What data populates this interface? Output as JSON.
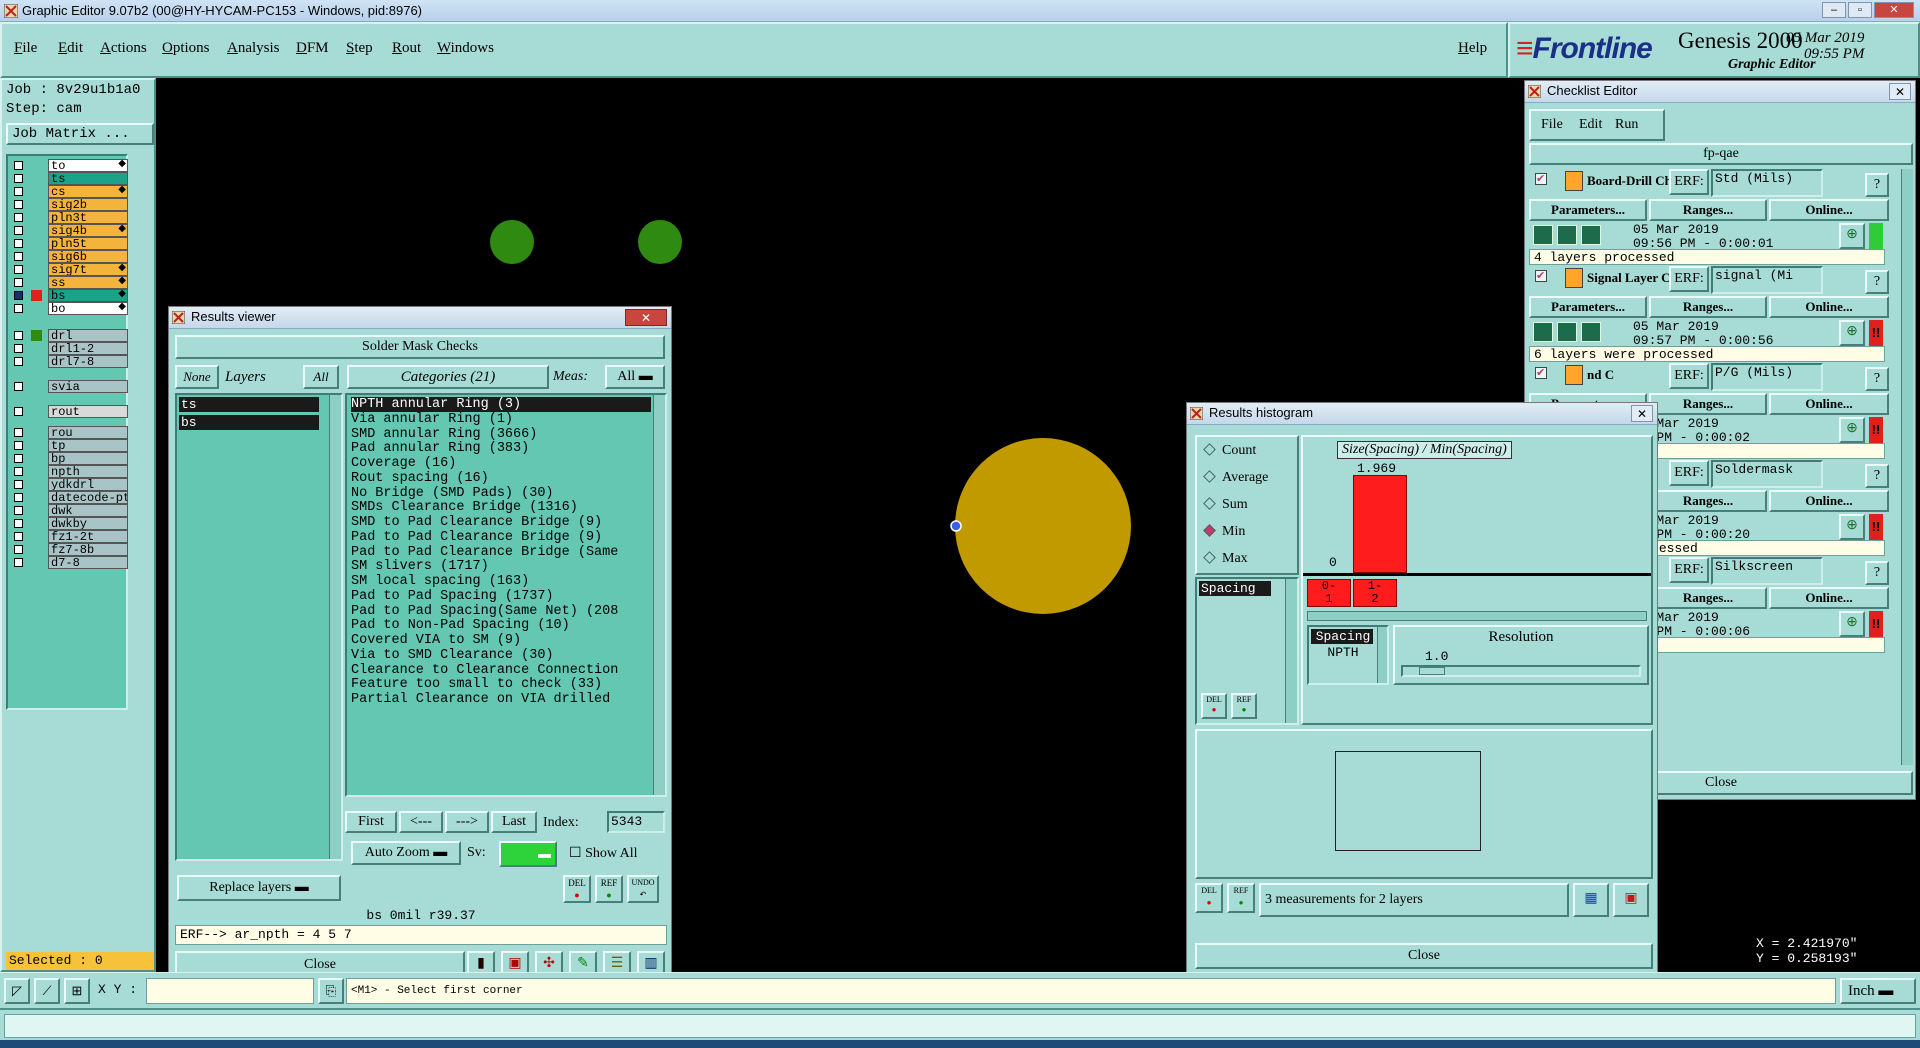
{
  "window": {
    "title": "Graphic Editor 9.07b2 (00@HY-HYCAM-PC153 - Windows, pid:8976)",
    "buttons": [
      "–",
      "▫",
      "✕"
    ]
  },
  "menu": {
    "items": [
      "File",
      "Edit",
      "Actions",
      "Options",
      "Analysis",
      "DFM",
      "Step",
      "Rout",
      "Windows"
    ],
    "help": "Help"
  },
  "brand": {
    "logo": "Frontline",
    "product": "Genesis 2000",
    "subtitle": "Graphic Editor",
    "date": "05 Mar 2019",
    "time": "09:55 PM"
  },
  "left": {
    "job": "Job : 8v29u1b1a0",
    "step": "Step: cam",
    "job_matrix": "Job Matrix ...",
    "selected": "Selected : 0",
    "layers": [
      {
        "name": "to",
        "color": "#ffffff",
        "mark": "◆"
      },
      {
        "name": "ts",
        "color": "#1aa389",
        "mark": ""
      },
      {
        "name": "cs",
        "color": "#f4b43c",
        "mark": "◆"
      },
      {
        "name": "sig2b",
        "color": "#f4b43c",
        "mark": ""
      },
      {
        "name": "pln3t",
        "color": "#f4b43c",
        "mark": ""
      },
      {
        "name": "sig4b",
        "color": "#f4b43c",
        "mark": "◆"
      },
      {
        "name": "pln5t",
        "color": "#f4b43c",
        "mark": ""
      },
      {
        "name": "sig6b",
        "color": "#f4b43c",
        "mark": ""
      },
      {
        "name": "sig7t",
        "color": "#f4b43c",
        "mark": "◆"
      },
      {
        "name": "ss",
        "color": "#f4b43c",
        "mark": "◆"
      },
      {
        "name": "bs",
        "color": "#1aa389",
        "mark": "◆"
      },
      {
        "name": "bo",
        "color": "#ffffff",
        "mark": "◆"
      },
      {
        "name": "drl",
        "color": "#a9c4c7",
        "mark": ""
      },
      {
        "name": "drl1-2",
        "color": "#a9c4c7",
        "mark": ""
      },
      {
        "name": "drl7-8",
        "color": "#a9c4c7",
        "mark": ""
      },
      {
        "name": "svia",
        "color": "#a9c4c7",
        "mark": ""
      },
      {
        "name": "rout",
        "color": "#d9d9d9",
        "mark": ""
      },
      {
        "name": "rou",
        "color": "#a9c4c7",
        "mark": ""
      },
      {
        "name": "tp",
        "color": "#a9c4c7",
        "mark": ""
      },
      {
        "name": "bp",
        "color": "#a9c4c7",
        "mark": ""
      },
      {
        "name": "npth",
        "color": "#a9c4c7",
        "mark": ""
      },
      {
        "name": "ydkdrl",
        "color": "#a9c4c7",
        "mark": ""
      },
      {
        "name": "datecode-pt",
        "color": "#a9c4c7",
        "mark": ""
      },
      {
        "name": "dwk",
        "color": "#a9c4c7",
        "mark": ""
      },
      {
        "name": "dwkby",
        "color": "#a9c4c7",
        "mark": ""
      },
      {
        "name": "fz1-2t",
        "color": "#a9c4c7",
        "mark": ""
      },
      {
        "name": "fz7-8b",
        "color": "#a9c4c7",
        "mark": ""
      },
      {
        "name": "d7-8",
        "color": "#a9c4c7",
        "mark": ""
      }
    ]
  },
  "results_viewer": {
    "title": "Results viewer",
    "header": "Solder Mask Checks",
    "none_btn": "None",
    "layers_label": "Layers",
    "all_btn": "All",
    "categories_label": "Categories (21)",
    "meas_label": "Meas:",
    "meas_value": "All",
    "layers": [
      "ts",
      "bs"
    ],
    "categories": [
      "NPTH annular Ring (3)",
      "Via annular Ring (1)",
      "SMD annular Ring (3666)",
      "Pad annular Ring (383)",
      "Coverage (16)",
      "Rout spacing (16)",
      "No Bridge (SMD Pads) (30)",
      "SMDs Clearance Bridge (1316)",
      "SMD to Pad Clearance Bridge (9)",
      "Pad to Pad Clearance Bridge (9)",
      "Pad to Pad Clearance Bridge (Same",
      "SM slivers (1717)",
      "SM local spacing (163)",
      "Pad to Pad Spacing (1737)",
      "Pad to Pad Spacing(Same Net) (208",
      "Pad to Non-Pad Spacing (10)",
      "Covered VIA to SM (9)",
      "Via to SMD Clearance (30)",
      "Clearance to Clearance Connection",
      "Feature too small to check (33)",
      "Partial Clearance on VIA drilled"
    ],
    "first": "First",
    "prev": "<---",
    "next": "--->",
    "last": "Last",
    "index_label": "Index:",
    "index_value": "5343",
    "auto_zoom": "Auto Zoom",
    "sv_label": "Sv:",
    "show_all": "Show All",
    "replace_layers": "Replace layers",
    "del": "DEL",
    "ref": "REF",
    "undo": "UNDO",
    "info_line": "bs 0mil  r39.37",
    "erf_line": "ERF--> ar_npth = 4 5 7",
    "close": "Close"
  },
  "histogram": {
    "title": "Results histogram",
    "modes": [
      "Count",
      "Average",
      "Sum",
      "Min",
      "Max"
    ],
    "active_mode": "Min",
    "list_item": "Spacing",
    "chart_title": "Size(Spacing) / Min(Spacing)",
    "bar_value": "1.969",
    "zero_label": "0",
    "bin_labels": [
      "0-\n1",
      "1-\n2"
    ],
    "table_items": [
      "Spacing",
      "NPTH"
    ],
    "resolution_label": "Resolution",
    "resolution_value": "1.0",
    "measurements": "3 measurements for 2 layers",
    "del": "DEL",
    "ref": "REF",
    "close": "Close"
  },
  "checklist": {
    "title": "Checklist Editor",
    "menu": [
      "File",
      "Edit",
      "Run"
    ],
    "name": "fp-qae",
    "erf_label": "ERF:",
    "params": "Parameters...",
    "ranges": "Ranges...",
    "online": "Online...",
    "close": "Close",
    "items": [
      {
        "name": "Board-Drill Che",
        "erf": "Std (Mils)",
        "date": "05 Mar 2019",
        "time": "09:56 PM - 0:00:01",
        "status": "4 layers processed",
        "flag": "#2fcc3a"
      },
      {
        "name": "Signal Layer Ch",
        "erf": "signal (Mi",
        "date": "05 Mar 2019",
        "time": "09:57 PM - 0:00:56",
        "status": "6 layers were processed",
        "flag": "#e0201c"
      },
      {
        "name": "nd C",
        "erf": "P/G (Mils)",
        "date": "05 Mar 2019",
        "time": "57 PM - 0:00:02",
        "status": "layers processed",
        "flag": "#e0201c"
      },
      {
        "name": "k Ch",
        "erf": "Soldermask",
        "date": "05 Mar 2019",
        "time": "57 PM - 0:00:20",
        "status": "layers were processed",
        "flag": "#e0201c"
      },
      {
        "name": "n Che",
        "erf": "Silkscreen",
        "date": "05 Mar 2019",
        "time": "57 PM - 0:00:06",
        "status": "layers processed",
        "flag": "#e0201c"
      }
    ]
  },
  "bottom": {
    "xy_label": "X Y :",
    "command": "<M1> - Select first corner",
    "units": "Inch",
    "x_readout": "X = 2.421970\"",
    "y_readout": "Y = 0.258193\""
  },
  "colors": {
    "panel": "#a7dcd6",
    "list_green": "#63c7b2",
    "pad_gold": "#c19a00",
    "pad_green": "#2e8a10",
    "bar_red": "#ff1c1c"
  }
}
